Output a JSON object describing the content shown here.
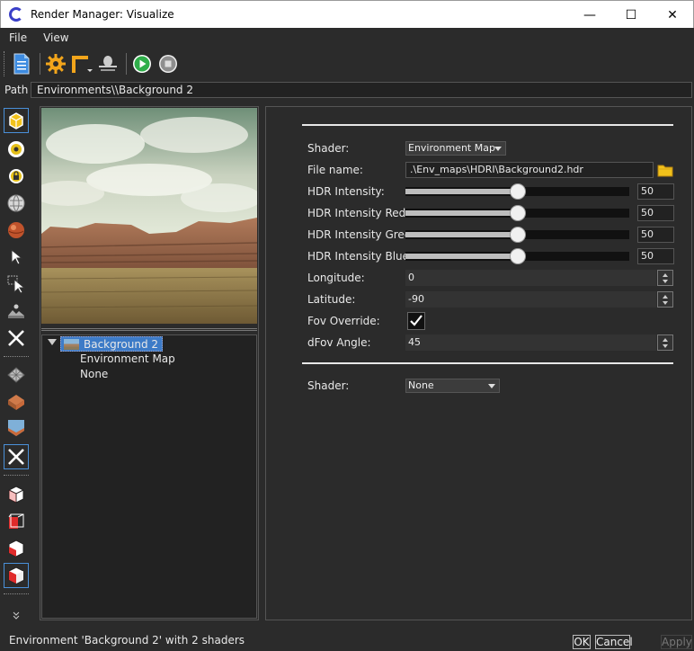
{
  "window": {
    "title": "Render Manager: Visualize",
    "minimize": "—",
    "maximize": "☐",
    "close": "✕"
  },
  "menu": [
    "File",
    "View"
  ],
  "toolbar": {
    "icons": [
      "document-icon",
      "settings-gear-icon",
      "frame-icon",
      "light-icon",
      "play-icon",
      "stop-icon"
    ]
  },
  "path": {
    "label": "Path",
    "value": "Environments\\\\Background 2"
  },
  "tree": {
    "root_label": "Background 2",
    "children": [
      "Environment Map",
      "None"
    ]
  },
  "properties": {
    "shader_label": "Shader:",
    "shader_value": "Environment Map",
    "file_label": "File name:",
    "file_value": ".\\Env_maps\\HDRI\\Background2.hdr",
    "sliders": [
      {
        "label": "HDR Intensity:",
        "value": "50",
        "fraction": 0.5
      },
      {
        "label": "HDR Intensity Red:",
        "value": "50",
        "fraction": 0.5
      },
      {
        "label": "HDR Intensity Green:",
        "value": "50",
        "fraction": 0.5
      },
      {
        "label": "HDR Intensity Blue:",
        "value": "50",
        "fraction": 0.5
      }
    ],
    "longitude_label": "Longitude:",
    "longitude_value": "0",
    "latitude_label": "Latitude:",
    "latitude_value": "-90",
    "fov_override_label": "Fov Override:",
    "fov_override_checked": true,
    "dfov_label": "dFov Angle:",
    "dfov_value": "45",
    "shader2_label": "Shader:",
    "shader2_value": "None"
  },
  "status": {
    "text": "Environment 'Background 2' with 2 shaders",
    "ok": "OK",
    "cancel": "Cancel",
    "apply": "Apply"
  },
  "colors": {
    "accent": "#3d7bc7",
    "background": "#2b2b2b"
  }
}
